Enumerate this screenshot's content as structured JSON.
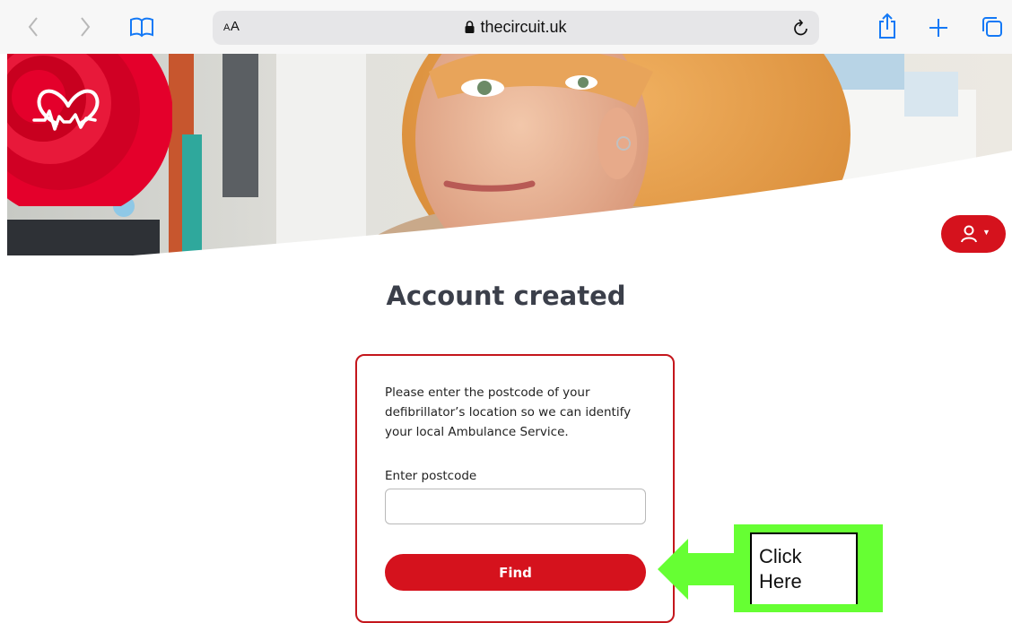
{
  "browser": {
    "text_size_label": "AA",
    "url": "thecircuit.uk"
  },
  "page": {
    "title": "Account created",
    "intro": "Please enter the postcode of your defibrillator’s location so we can identify your local Ambulance Service.",
    "postcode_label": "Enter postcode",
    "postcode_value": "",
    "find_label": "Find"
  },
  "annotation": {
    "text": "Click\nHere"
  },
  "colors": {
    "brand_red": "#d5121d",
    "annotation_green": "#66ff33"
  },
  "icons": [
    "back-icon",
    "forward-icon",
    "bookmarks-icon",
    "lock-icon",
    "reload-icon",
    "share-icon",
    "new-tab-icon",
    "tabs-icon",
    "heart-logo-icon",
    "user-icon",
    "caret-down-icon",
    "arrow-left-icon"
  ]
}
